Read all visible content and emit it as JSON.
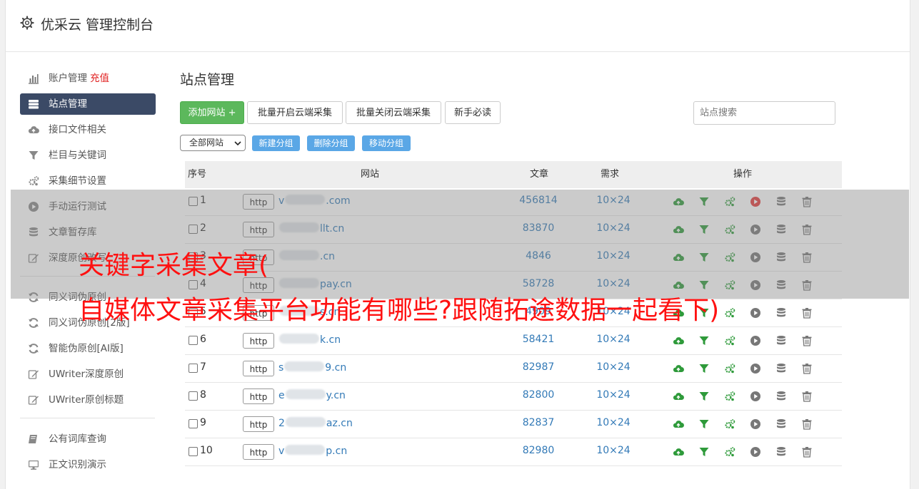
{
  "header": {
    "title": "优采云 管理控制台",
    "icon": "gear-icon"
  },
  "sidebar": {
    "groups": [
      [
        {
          "label": "账户管理",
          "badge": "充值",
          "icon": "bar-chart-icon",
          "active": false
        },
        {
          "label": "站点管理",
          "icon": "server-icon",
          "active": true
        },
        {
          "label": "接口文件相关",
          "icon": "cloud-upload-icon",
          "active": false
        },
        {
          "label": "栏目与关键词",
          "icon": "filter-icon",
          "active": false
        },
        {
          "label": "采集细节设置",
          "icon": "gears-icon",
          "active": false
        },
        {
          "label": "手动运行测试",
          "icon": "play-icon",
          "active": false
        },
        {
          "label": "文章暂存库",
          "icon": "database-icon",
          "active": false
        },
        {
          "label": "深度原创改写",
          "icon": "edit-icon",
          "active": false
        }
      ],
      [
        {
          "label": "同义词伪原创",
          "icon": "refresh-icon",
          "active": false
        },
        {
          "label": "同义词伪原创[2版]",
          "icon": "refresh-icon",
          "active": false
        },
        {
          "label": "智能伪原创[AI版]",
          "icon": "refresh-icon",
          "active": false
        },
        {
          "label": "UWriter深度原创",
          "icon": "edit-icon",
          "active": false
        },
        {
          "label": "UWriter原创标题",
          "icon": "edit-icon",
          "active": false
        }
      ],
      [
        {
          "label": "公有词库查询",
          "icon": "book-icon",
          "active": false
        },
        {
          "label": "正文识别演示",
          "icon": "monitor-icon",
          "active": false
        }
      ]
    ]
  },
  "main": {
    "title": "站点管理",
    "buttons": {
      "add_site": "添加网站 +",
      "enable_cloud": "批量开启云端采集",
      "disable_cloud": "批量关闭云端采集",
      "newbie": "新手必读"
    },
    "search_placeholder": "站点搜索",
    "group_select": "全部网站",
    "group_buttons": {
      "new_group": "新建分组",
      "delete_group": "删除分组",
      "move_group": "移动分组"
    },
    "table": {
      "headers": {
        "index": "序号",
        "site": "网站",
        "articles": "文章",
        "demand": "需求",
        "actions": "操作"
      },
      "rows": [
        {
          "index": "1",
          "prefix": "http",
          "site_start": "v",
          "site_end": ".com",
          "articles": "456814",
          "demand": "10×24",
          "play_active": true
        },
        {
          "index": "2",
          "prefix": "http",
          "site_start": "",
          "site_end": "llt.cn",
          "articles": "83870",
          "demand": "10×24",
          "play_active": false
        },
        {
          "index": "3",
          "prefix": "http",
          "site_start": "",
          "site_end": ".cn",
          "articles": "4846",
          "demand": "10×24",
          "play_active": false
        },
        {
          "index": "4",
          "prefix": "http",
          "site_start": "",
          "site_end": "pay.cn",
          "articles": "58728",
          "demand": "10×24",
          "play_active": false
        },
        {
          "index": "5",
          "prefix": "http",
          "site_start": "",
          "site_end": "s.cn",
          "articles": "4909",
          "demand": "10×24",
          "play_active": false
        },
        {
          "index": "6",
          "prefix": "http",
          "site_start": "",
          "site_end": "k.cn",
          "articles": "58421",
          "demand": "10×24",
          "play_active": false
        },
        {
          "index": "7",
          "prefix": "http",
          "site_start": "s",
          "site_end": "9.cn",
          "articles": "82987",
          "demand": "10×24",
          "play_active": false
        },
        {
          "index": "8",
          "prefix": "http",
          "site_start": "e",
          "site_end": "y.cn",
          "articles": "82800",
          "demand": "10×24",
          "play_active": false
        },
        {
          "index": "9",
          "prefix": "http",
          "site_start": "2",
          "site_end": "az.cn",
          "articles": "82837",
          "demand": "10×24",
          "play_active": false
        },
        {
          "index": "10",
          "prefix": "http",
          "site_start": "v",
          "site_end": "p.cn",
          "articles": "82980",
          "demand": "10×24",
          "play_active": false
        }
      ]
    }
  },
  "overlay": {
    "line1": "关键字采集文章(",
    "line2": "自媒体文章采集平台功能有哪些?跟随拓途数据一起看下)"
  },
  "colors": {
    "accent": "#3b4a66",
    "green": "#5cb85c",
    "blue": "#5aa7e6",
    "link": "#337ab7",
    "headline": "#ff1111"
  }
}
